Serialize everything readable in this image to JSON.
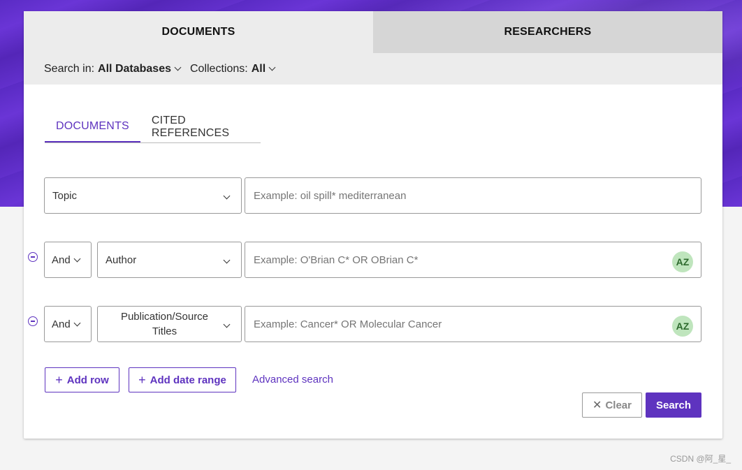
{
  "top_tabs": {
    "documents": "DOCUMENTS",
    "researchers": "RESEARCHERS"
  },
  "filters": {
    "search_in_label": "Search in:",
    "search_in_value": "All Databases",
    "collections_label": "Collections:",
    "collections_value": "All"
  },
  "sub_tabs": {
    "documents": "DOCUMENTS",
    "cited_references": "CITED REFERENCES"
  },
  "rows": [
    {
      "field": "Topic",
      "placeholder": "Example: oil spill* mediterranean"
    },
    {
      "operator": "And",
      "field": "Author",
      "placeholder": "Example: O'Brian C* OR OBrian C*",
      "az": "AZ"
    },
    {
      "operator": "And",
      "field": "Publication/Source Titles",
      "placeholder": "Example: Cancer* OR Molecular Cancer",
      "az": "AZ"
    }
  ],
  "actions": {
    "add_row": "Add row",
    "add_date_range": "Add date range",
    "advanced_search": "Advanced search",
    "clear": "Clear",
    "search": "Search"
  },
  "watermark": "CSDN @阿_星_",
  "colors": {
    "accent": "#5e33bf",
    "hero": "#5a2bc4",
    "az_badge": "#bfe5bd"
  }
}
